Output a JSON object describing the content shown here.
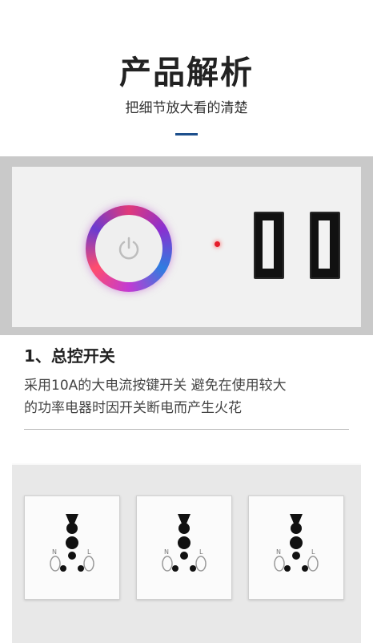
{
  "header": {
    "title": "产品解析",
    "subtitle": "把细节放大看的清楚",
    "accent_color": "#1d4f8c"
  },
  "feature": {
    "heading": "1、总控开关",
    "description_line1": "采用10A的大电流按键开关  避免在使用较大",
    "description_line2": "的功率电器时因开关断电而产生火花"
  },
  "product_photo_top": {
    "elements": [
      "power-button-icon",
      "indicator-led",
      "usb-port",
      "usb-port"
    ]
  },
  "product_photo_bottom": {
    "sockets": [
      {
        "label_n": "N",
        "label_l": "L"
      },
      {
        "label_n": "N",
        "label_l": "L"
      },
      {
        "label_n": "N",
        "label_l": "L"
      }
    ]
  }
}
